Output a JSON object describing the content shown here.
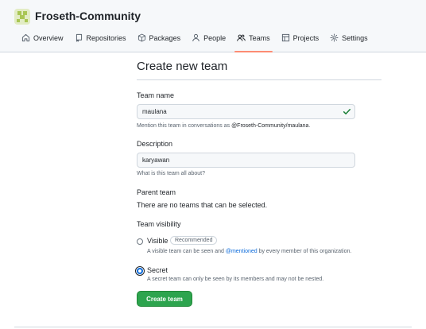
{
  "org": {
    "name": "Froseth-Community",
    "logo_icon": "identicon-logo"
  },
  "nav": {
    "tabs": [
      {
        "label": "Overview",
        "icon": "home-icon"
      },
      {
        "label": "Repositories",
        "icon": "repo-icon"
      },
      {
        "label": "Packages",
        "icon": "package-icon"
      },
      {
        "label": "People",
        "icon": "person-icon"
      },
      {
        "label": "Teams",
        "icon": "people-icon",
        "selected": true
      },
      {
        "label": "Projects",
        "icon": "table-icon"
      },
      {
        "label": "Settings",
        "icon": "gear-icon"
      }
    ]
  },
  "form": {
    "title": "Create new team",
    "team_name": {
      "label": "Team name",
      "value": "maulana",
      "note_prefix": "Mention this team in conversations as ",
      "note_handle": "@Froseth-Community/maulana",
      "note_suffix": "."
    },
    "description": {
      "label": "Description",
      "value": "karyawan",
      "note": "What is this team all about?"
    },
    "parent_team": {
      "label": "Parent team",
      "text": "There are no teams that can be selected."
    },
    "visibility": {
      "label": "Team visibility",
      "visible": {
        "label": "Visible",
        "badge": "Recommended",
        "note_prefix": "A visible team can be seen and ",
        "note_link": "@mentioned",
        "note_suffix": " by every member of this organization.",
        "checked": false
      },
      "secret": {
        "label": "Secret",
        "note": "A secret team can only be seen by its members and may not be nested.",
        "checked": true
      }
    },
    "submit_label": "Create team"
  },
  "colors": {
    "accent": "#2da44e",
    "link": "#0969da",
    "tab_underline": "#fd8c73",
    "valid_check": "#1a7f37"
  }
}
